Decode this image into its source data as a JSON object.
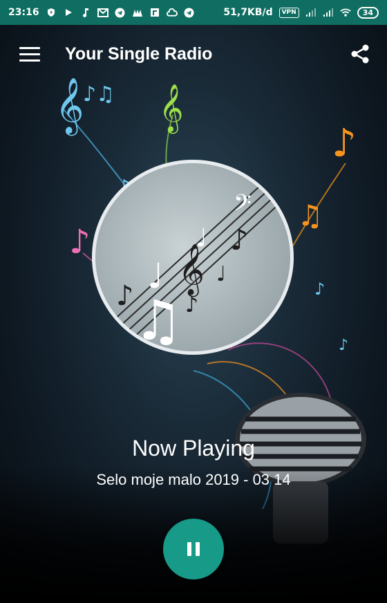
{
  "status_bar": {
    "time": "23:16",
    "network_speed": "51,7KB/d",
    "vpn": "VPN",
    "battery": "34",
    "icons": [
      "shield-icon",
      "play-icon",
      "music-note-icon",
      "gmail-icon",
      "telegram-icon",
      "app-icon",
      "flipboard-icon",
      "cloud-icon",
      "telegram-icon",
      "signal-icon",
      "signal-icon",
      "wifi-icon",
      "battery-icon"
    ]
  },
  "toolbar": {
    "title": "Your Single Radio",
    "menu_icon": "hamburger-menu-icon",
    "share_icon": "share-icon"
  },
  "player": {
    "now_playing_label": "Now Playing",
    "track_title": "Selo moje malo 2019 - 03 14",
    "control_icon": "pause-icon"
  },
  "colors": {
    "status_bar": "#0f6e61",
    "accent": "#179a88",
    "text": "#ffffff"
  }
}
